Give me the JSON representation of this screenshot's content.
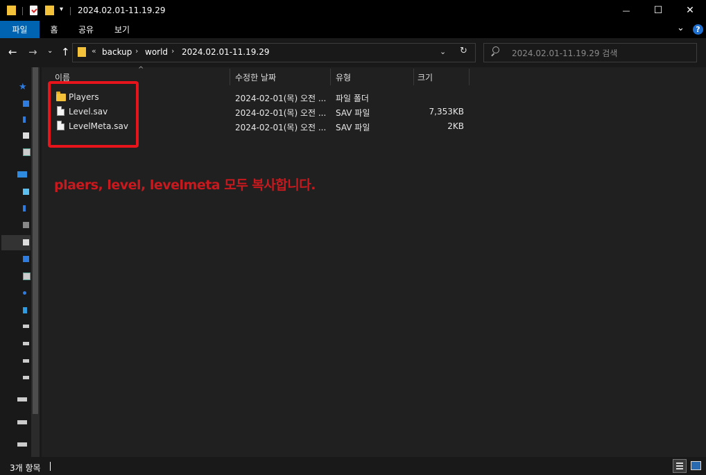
{
  "window": {
    "title": "2024.02.01-11.19.29",
    "minimize": "—",
    "maximize": "☐",
    "close": "✕"
  },
  "ribbon": {
    "tabs": [
      "파일",
      "홈",
      "공유",
      "보기"
    ],
    "expand": "⌄",
    "help": "?"
  },
  "address": {
    "overflow": "«",
    "crumbs": [
      "backup",
      "world",
      "2024.02.01-11.19.29"
    ],
    "separator": "›"
  },
  "search": {
    "placeholder": "2024.02.01-11.19.29 검색"
  },
  "columns": {
    "name": "이름",
    "modified": "수정한 날짜",
    "type": "유형",
    "size": "크기",
    "sort_indicator": "^"
  },
  "files": [
    {
      "name": "Players",
      "modified": "2024-02-01(목) 오전 ...",
      "type": "파일 폴더",
      "size": "",
      "icon": "folder-icon"
    },
    {
      "name": "Level.sav",
      "modified": "2024-02-01(목) 오전 ...",
      "type": "SAV 파일",
      "size": "7,353KB",
      "icon": "file-icon"
    },
    {
      "name": "LevelMeta.sav",
      "modified": "2024-02-01(목) 오전 ...",
      "type": "SAV 파일",
      "size": "2KB",
      "icon": "file-icon"
    }
  ],
  "annotation": "plaers, level, levelmeta 모두 복사합니다.",
  "status": {
    "item_count": "3개 항목"
  },
  "colors": {
    "accent": "#0063b1",
    "highlight": "#e8141c",
    "background": "#202020"
  }
}
